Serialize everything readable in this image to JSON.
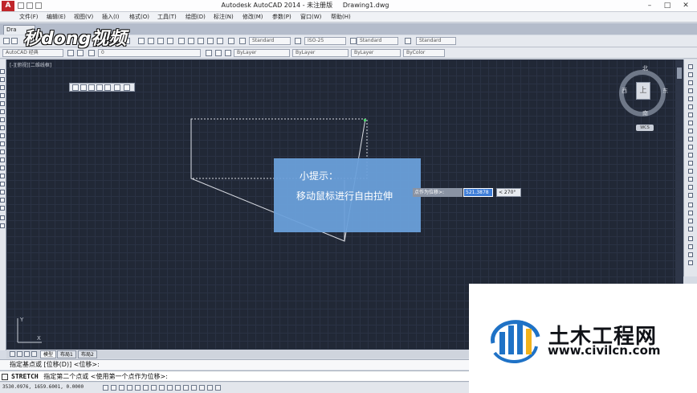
{
  "window": {
    "app_logo": "A",
    "title": "Autodesk AutoCAD 2014 - 未注册版     Drawing1.dwg",
    "controls": [
      "–",
      "□",
      "✕"
    ]
  },
  "menu": [
    "文件(F)",
    "编辑(E)",
    "视图(V)",
    "插入(I)",
    "格式(O)",
    "工具(T)",
    "绘图(D)",
    "标注(N)",
    "修改(M)",
    "参数(P)",
    "窗口(W)",
    "帮助(H)"
  ],
  "tabs": {
    "drawing_tab": "Dra"
  },
  "toolbar": {
    "text_style": "Standard",
    "dim_style": "ISO-25",
    "table_style": "Standard",
    "mleader_style": "Standard",
    "workspace": "AutoCAD 经典",
    "layer": "0",
    "color": "ByLayer",
    "linetype": "ByLayer",
    "lineweight": "ByLayer",
    "plotstyle": "ByColor"
  },
  "viewport": {
    "label": "[-][俯视][二维线框]"
  },
  "viewcube": {
    "north": "北",
    "south": "南",
    "east": "东",
    "west": "西",
    "face": "上",
    "wcs": "WCS"
  },
  "tooltip": {
    "title": "小提示：",
    "body": "移动鼠标进行自由拉伸"
  },
  "dynamic_input": {
    "prompt": "点作为位移>:",
    "value": "521.3878",
    "angle": "< 270°"
  },
  "layout_tabs": [
    "模型",
    "布局1",
    "布局2"
  ],
  "command": {
    "history": "指定基点或 [位移(D)] <位移>:",
    "prompt_cmd": "STRETCH",
    "prompt_text": "指定第二个点或 <使用第一个点作为位移>:"
  },
  "status": {
    "coords": "3530.0976, 1659.6001, 0.0000"
  },
  "watermark": {
    "brand": "秒dong视频",
    "site_cn": "土木工程网",
    "site_url": "www.civilcn.com"
  },
  "colors": {
    "canvas": "#212836",
    "tooltip": "#6aa0db",
    "logo_blue": "#1f72c6"
  }
}
